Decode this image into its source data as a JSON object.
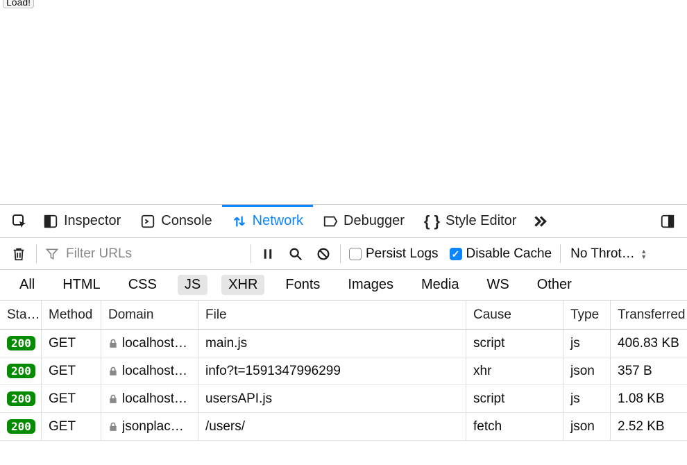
{
  "page": {
    "load_button": "Load!"
  },
  "devtools": {
    "tabs": {
      "inspector": "Inspector",
      "console": "Console",
      "network": "Network",
      "debugger": "Debugger",
      "style_editor": "Style Editor"
    },
    "active_tab": "network"
  },
  "network_toolbar": {
    "filter_placeholder": "Filter URLs",
    "persist_logs": {
      "label": "Persist Logs",
      "checked": false
    },
    "disable_cache": {
      "label": "Disable Cache",
      "checked": true
    },
    "throttling_label": "No Throttli…"
  },
  "filters": {
    "items": [
      "All",
      "HTML",
      "CSS",
      "JS",
      "XHR",
      "Fonts",
      "Images",
      "Media",
      "WS",
      "Other"
    ],
    "active": [
      "JS",
      "XHR"
    ]
  },
  "columns": {
    "status": "Sta…",
    "method": "Method",
    "domain": "Domain",
    "file": "File",
    "cause": "Cause",
    "type": "Type",
    "transferred": "Transferred"
  },
  "requests": [
    {
      "status": "200",
      "method": "GET",
      "domain": "localhost:…",
      "file": "main.js",
      "cause": "script",
      "type": "js",
      "transferred": "406.83 KB"
    },
    {
      "status": "200",
      "method": "GET",
      "domain": "localhost:…",
      "file": "info?t=1591347996299",
      "cause": "xhr",
      "type": "json",
      "transferred": "357 B"
    },
    {
      "status": "200",
      "method": "GET",
      "domain": "localhost:…",
      "file": "usersAPI.js",
      "cause": "script",
      "type": "js",
      "transferred": "1.08 KB"
    },
    {
      "status": "200",
      "method": "GET",
      "domain": "jsonplace…",
      "file": "/users/",
      "cause": "fetch",
      "type": "json",
      "transferred": "2.52 KB"
    }
  ]
}
